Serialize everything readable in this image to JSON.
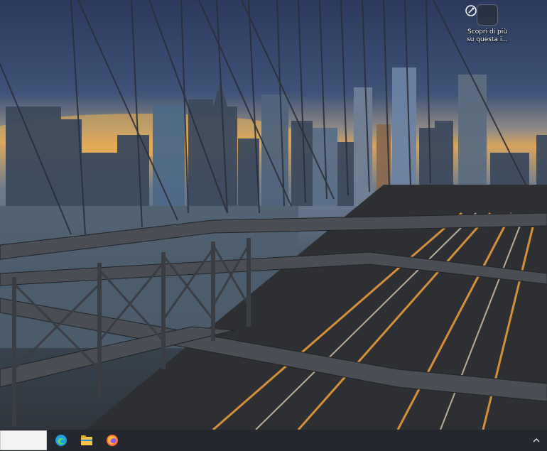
{
  "spotlight": {
    "label_line1": "Scopri di più",
    "label_line2": "su questa i..."
  },
  "taskbar": {
    "search_placeholder": "",
    "apps": [
      {
        "name": "edge-icon",
        "color": "#1ba0e1"
      },
      {
        "name": "file-explorer-icon",
        "color": "#f6c343"
      },
      {
        "name": "firefox-icon",
        "color": "#ff7139"
      }
    ],
    "tray_chevron": "^"
  },
  "colors": {
    "taskbar_bg": "#24282e",
    "search_bg": "#f3f3f3"
  }
}
